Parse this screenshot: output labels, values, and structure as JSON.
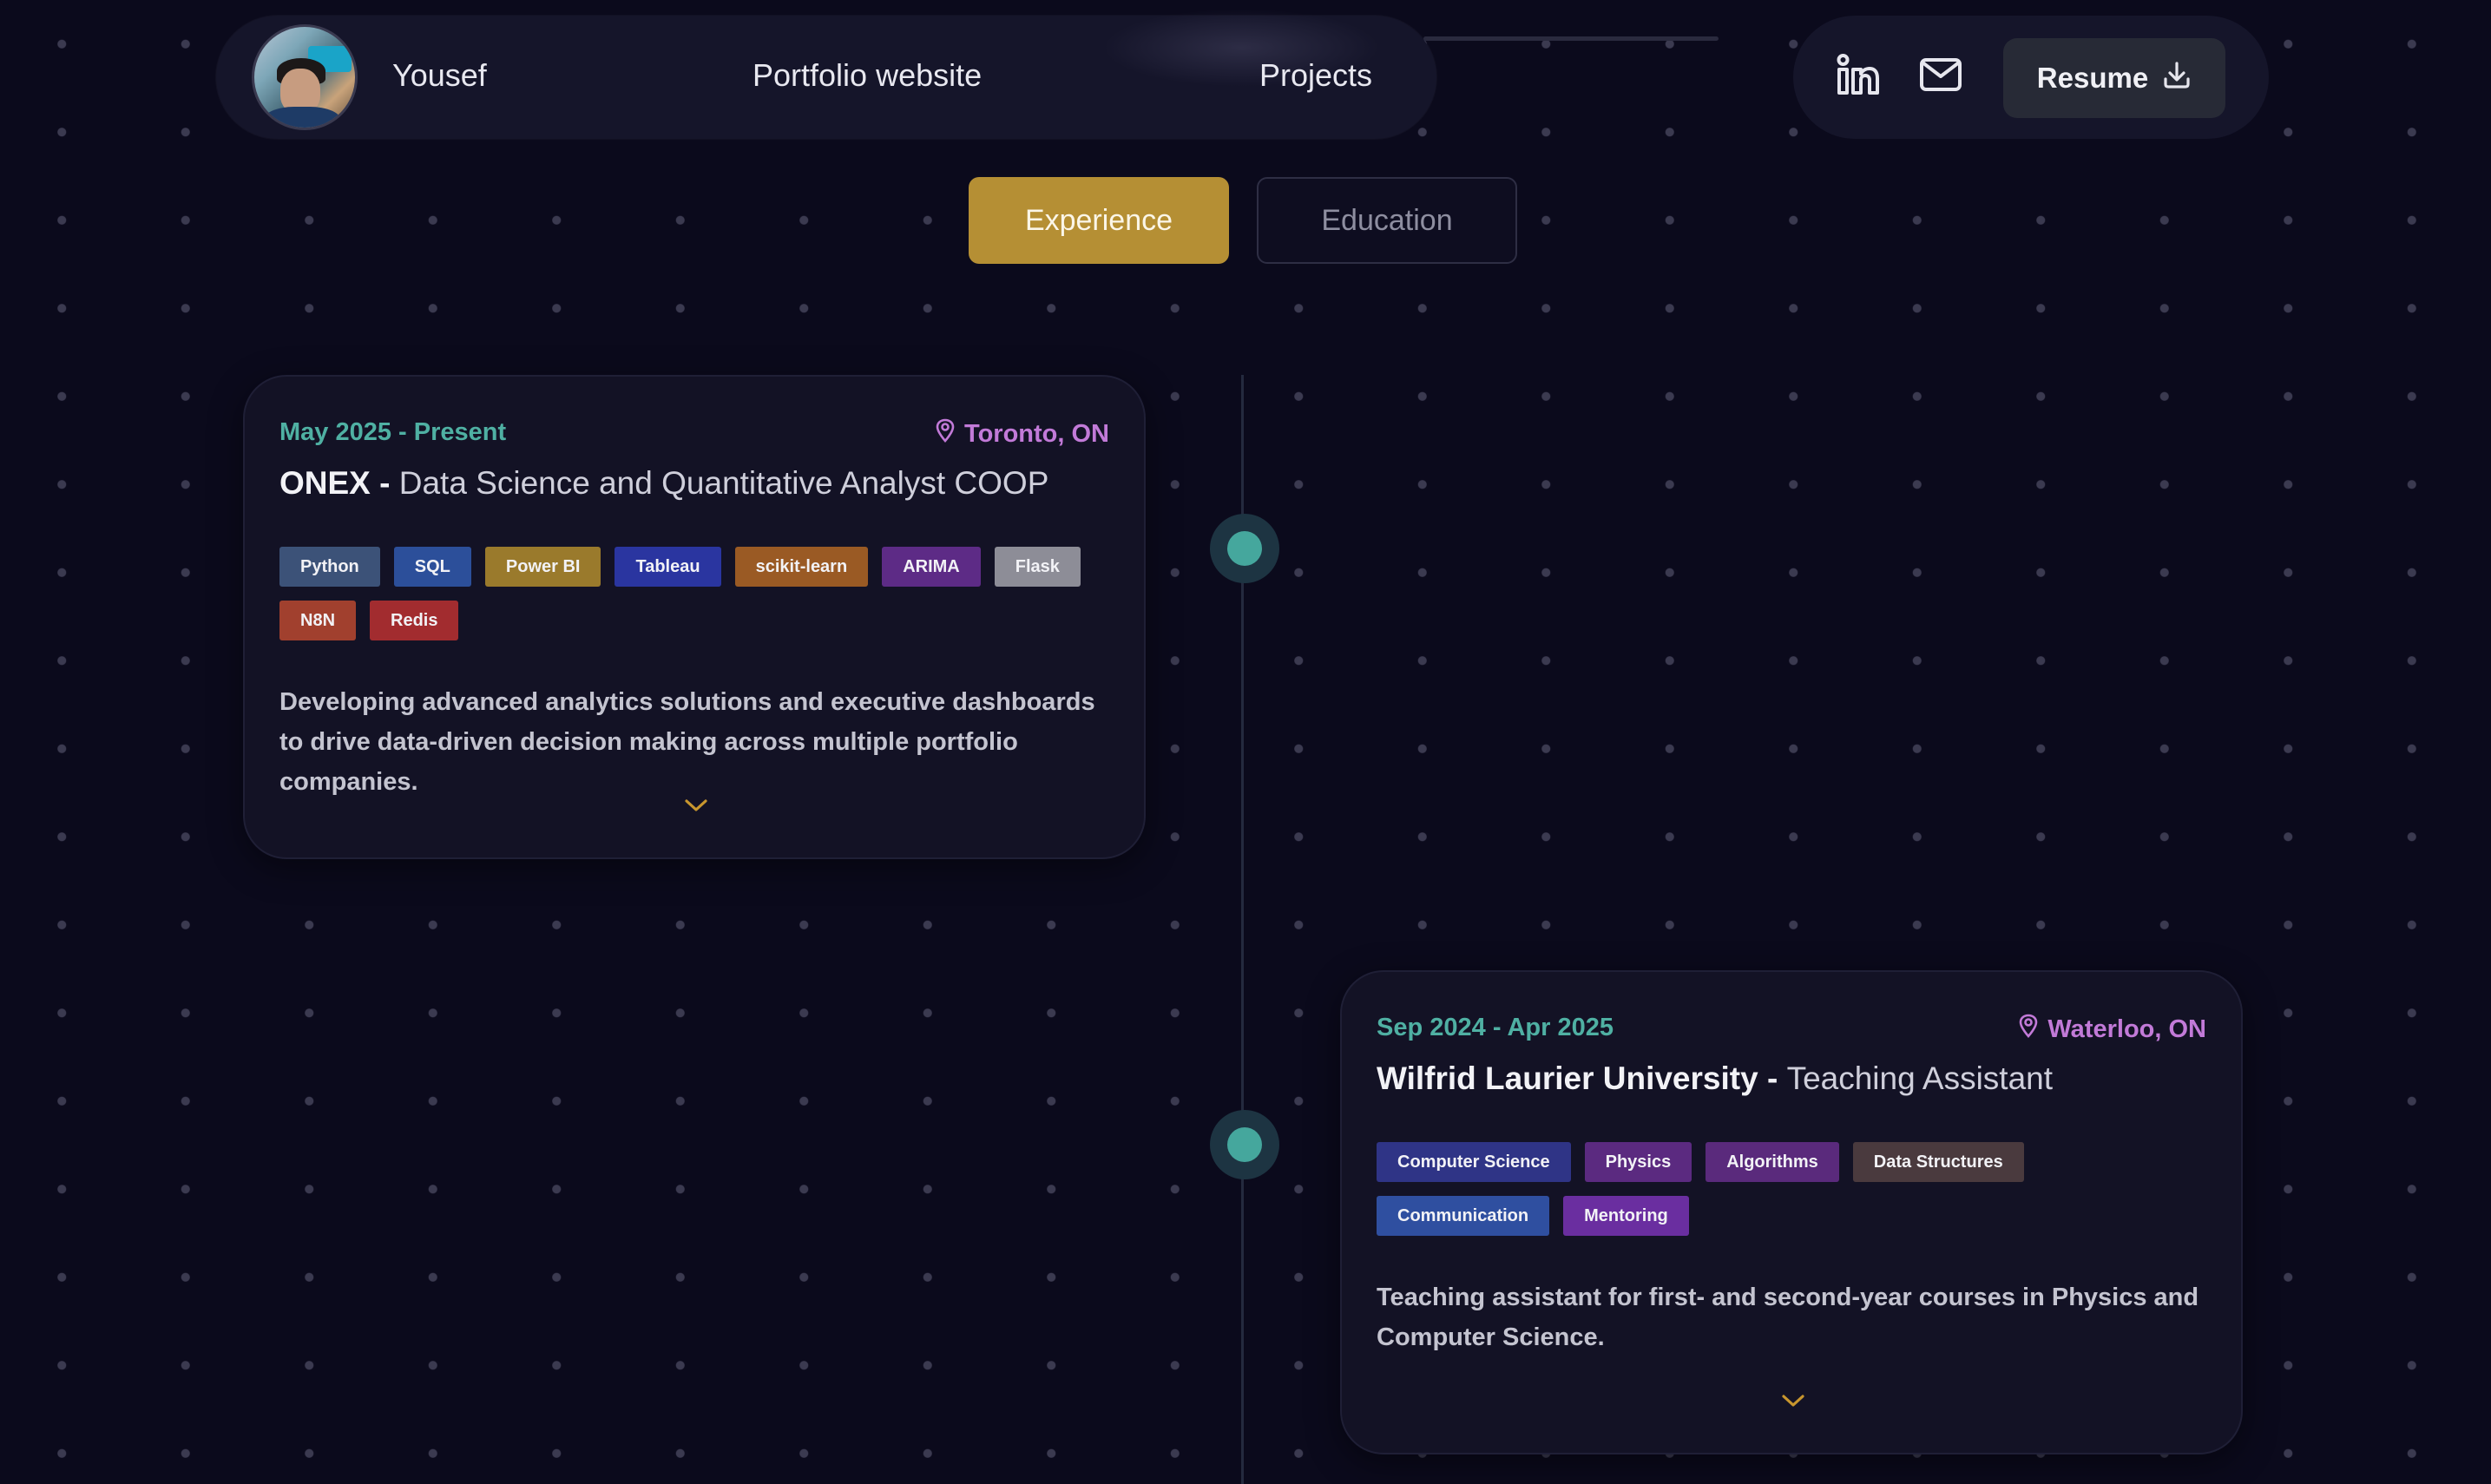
{
  "nav": {
    "name": "Yousef",
    "links": [
      "Portfolio website",
      "Projects"
    ],
    "resume_label": "Resume",
    "icons": [
      "linkedin-icon",
      "mail-icon",
      "download-icon"
    ]
  },
  "tabs": {
    "experience": "Experience",
    "education": "Education",
    "active": "Experience"
  },
  "colors": {
    "accent": "#b58f34",
    "date": "#4fb0a3",
    "location": "#c27ad8",
    "node": "#45a79d",
    "background": "#0b0a1c"
  },
  "experiences": [
    {
      "date": "May 2025 - Present",
      "location": "Toronto, ON",
      "company": "ONEX",
      "separator": " - ",
      "role": "Data Science and Quantitative Analyst COOP",
      "tags": [
        {
          "label": "Python",
          "color": "#3c5278"
        },
        {
          "label": "SQL",
          "color": "#2c4f9a"
        },
        {
          "label": "Power BI",
          "color": "#9a7a2c"
        },
        {
          "label": "Tableau",
          "color": "#2a35a0"
        },
        {
          "label": "scikit-learn",
          "color": "#9a5a24"
        },
        {
          "label": "ARIMA",
          "color": "#5d2b86"
        },
        {
          "label": "Flask",
          "color": "#8d8d97"
        },
        {
          "label": "N8N",
          "color": "#a1402e"
        },
        {
          "label": "Redis",
          "color": "#a22c2f"
        }
      ],
      "description": "Developing advanced analytics solutions and executive dashboards to drive data-driven decision making across multiple portfolio companies."
    },
    {
      "date": "Sep 2024 - Apr 2025",
      "location": "Waterloo, ON",
      "company": "Wilfrid Laurier University",
      "separator": " - ",
      "role": "Teaching Assistant",
      "tags": [
        {
          "label": "Computer Science",
          "color": "#2f3486"
        },
        {
          "label": "Physics",
          "color": "#5b2a80"
        },
        {
          "label": "Algorithms",
          "color": "#5a2a7c"
        },
        {
          "label": "Data Structures",
          "color": "#4a3a3e"
        },
        {
          "label": "Communication",
          "color": "#2f4fa0"
        },
        {
          "label": "Mentoring",
          "color": "#6a2ea0"
        }
      ],
      "description": "Teaching assistant for first- and second-year courses in Physics and Computer Science."
    }
  ]
}
